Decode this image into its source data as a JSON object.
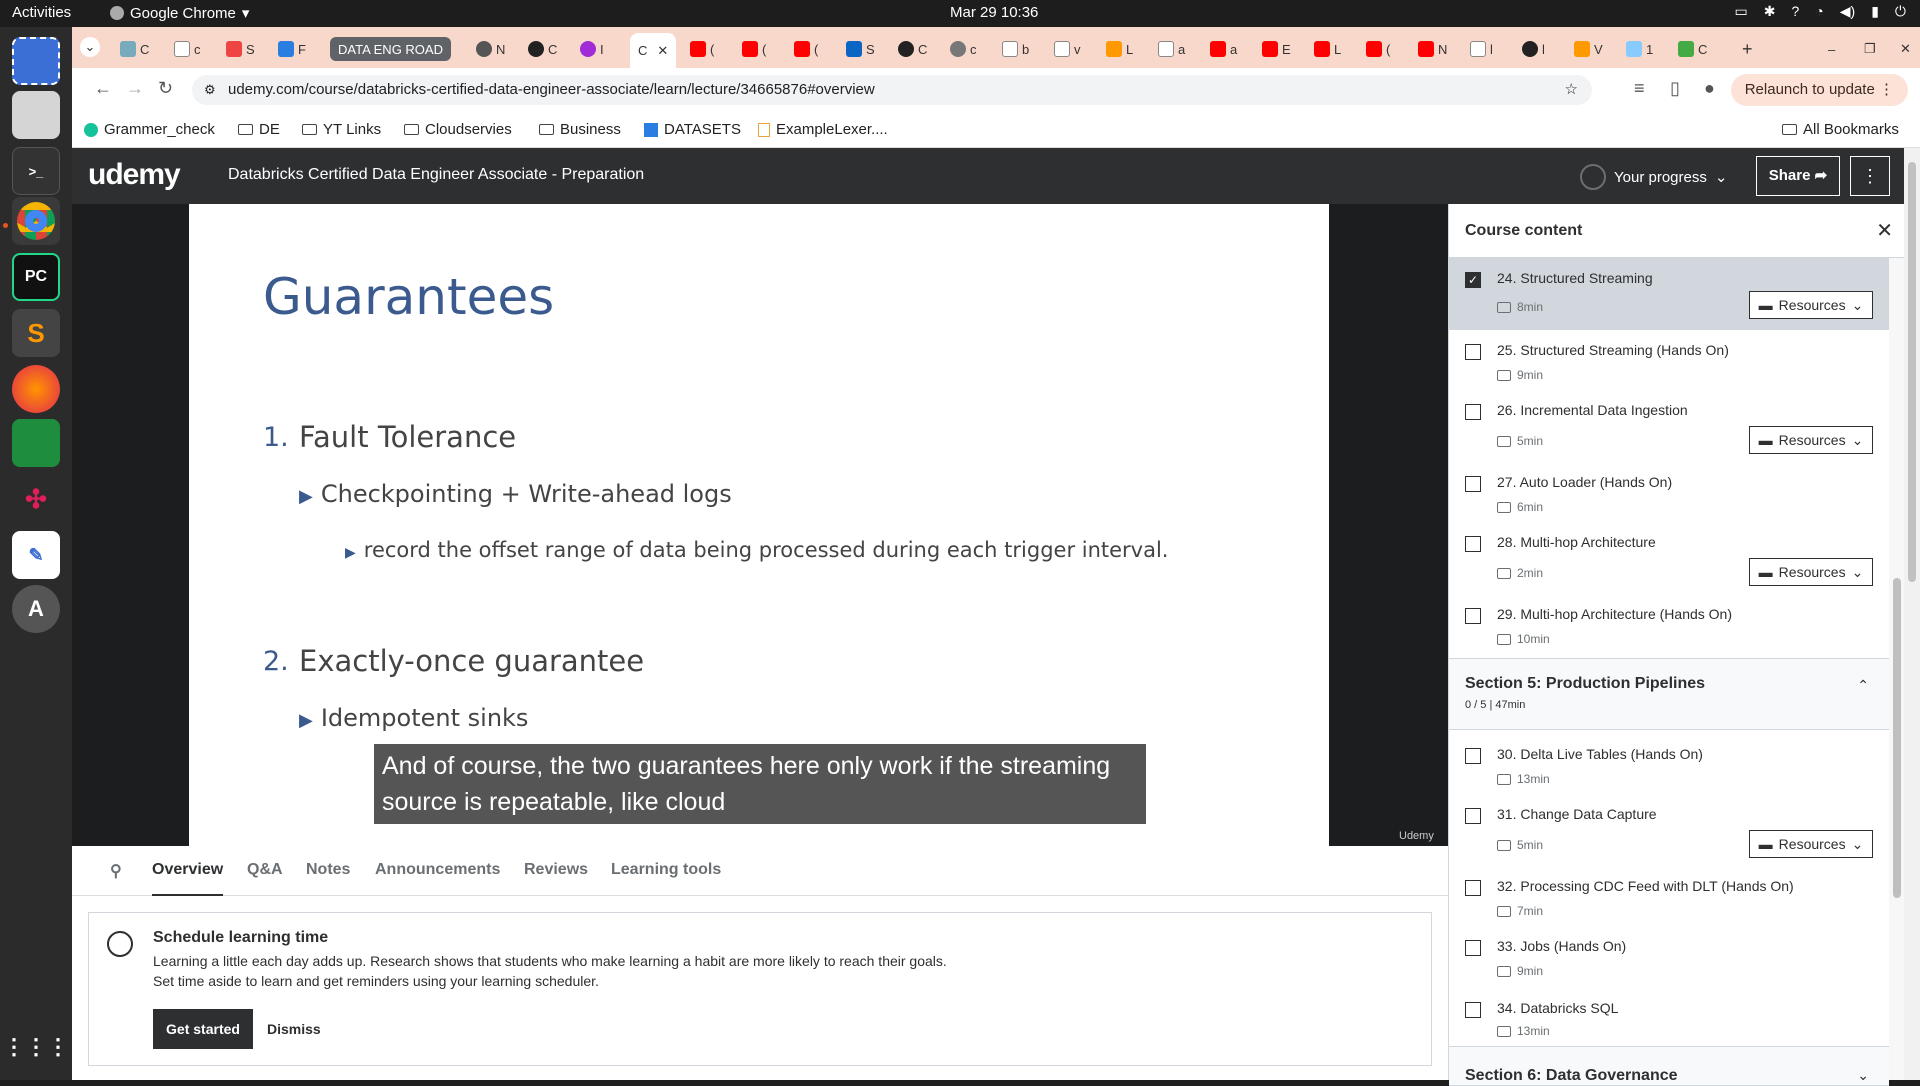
{
  "os": {
    "activities": "Activities",
    "app_name": "Google Chrome",
    "clock": "Mar 29  10:36"
  },
  "browser": {
    "active_tab_title": "C",
    "group_tab_label": "DATA ENG ROAD",
    "url": "udemy.com/course/databricks-certified-data-engineer-associate/learn/lecture/34665876#overview",
    "relaunch_label": "Relaunch to update",
    "bookmarks": [
      "Grammer_check",
      "DE",
      "YT Links",
      "Cloudservies",
      "Business",
      "DATASETS",
      "ExampleLexer...."
    ],
    "all_bookmarks": "All Bookmarks"
  },
  "header": {
    "logo": "udemy",
    "course_title": "Databricks Certified Data Engineer Associate - Preparation",
    "progress_label": "Your progress",
    "share_label": "Share"
  },
  "slide": {
    "title": "Guarantees",
    "item1_num": "1.",
    "item1": "Fault Tolerance",
    "item1_sub": "Checkpointing + Write-ahead logs",
    "item1_subsub": "record the offset range of data being processed during each trigger interval.",
    "item2_num": "2.",
    "item2": "Exactly-once guarantee",
    "item2_sub": "Idempotent sinks",
    "caption": "And of course, the two guarantees here only work if the streaming source is repeatable, like cloud",
    "watermark": "Udemy"
  },
  "tabs": [
    "Overview",
    "Q&A",
    "Notes",
    "Announcements",
    "Reviews",
    "Learning tools"
  ],
  "schedule": {
    "title": "Schedule learning time",
    "line1": "Learning a little each day adds up. Research shows that students who make learning a habit are more likely to reach their goals.",
    "line2": "Set time aside to learn and get reminders using your learning scheduler.",
    "primary": "Get started",
    "secondary": "Dismiss"
  },
  "sidebar": {
    "title": "Course content",
    "resources_label": "Resources",
    "lectures": [
      {
        "label": "24. Structured Streaming",
        "dur": "8min"
      },
      {
        "label": "25. Structured Streaming (Hands On)",
        "dur": "9min"
      },
      {
        "label": "26. Incremental Data Ingestion",
        "dur": "5min"
      },
      {
        "label": "27. Auto Loader (Hands On)",
        "dur": "6min"
      },
      {
        "label": "28. Multi-hop Architecture",
        "dur": "2min"
      },
      {
        "label": "29. Multi-hop Architecture (Hands On)",
        "dur": "10min"
      },
      {
        "label": "30. Delta Live Tables (Hands On)",
        "dur": "13min"
      },
      {
        "label": "31. Change Data Capture",
        "dur": "5min"
      },
      {
        "label": "32. Processing CDC Feed with DLT (Hands On)",
        "dur": "7min"
      },
      {
        "label": "33. Jobs (Hands On)",
        "dur": "9min"
      },
      {
        "label": "34. Databricks SQL",
        "dur": "13min"
      }
    ],
    "section5": {
      "title": "Section 5: Production Pipelines",
      "sub": "0 / 5 | 47min"
    },
    "section6": {
      "title": "Section 6: Data Governance"
    }
  }
}
